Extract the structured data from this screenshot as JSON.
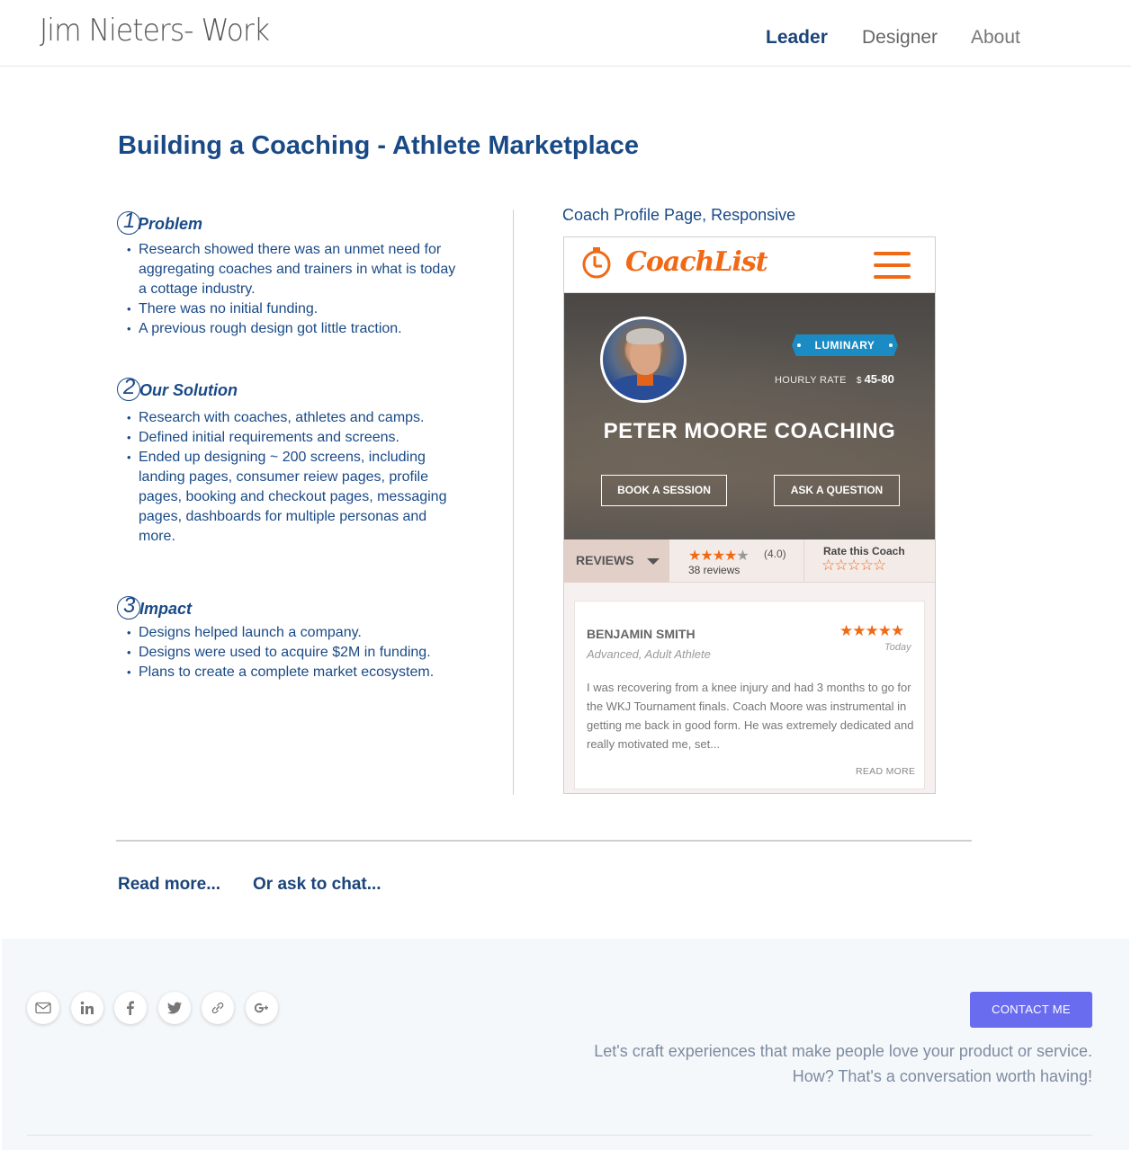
{
  "header": {
    "logo": "Jim Nieters- Work",
    "nav": [
      "Leader",
      "Designer",
      "About"
    ]
  },
  "page_title": "Building a Coaching - Athlete Marketplace",
  "sections": [
    {
      "number": "1",
      "title": "Problem",
      "bullets": [
        "Research showed there was an unmet need for aggregating coaches and trainers in what is today a cottage industry.",
        "There was no initial funding.",
        "A previous rough design got little traction."
      ]
    },
    {
      "number": "2",
      "title": "Our Solution",
      "bullets": [
        "Research with coaches, athletes and camps.",
        "Defined initial requirements and screens.",
        "Ended up designing ~ 200 screens, including landing pages, consumer reiew pages, profile pages, booking and checkout pages, messaging pages, dashboards for multiple personas and more."
      ]
    },
    {
      "number": "3",
      "title": "Impact",
      "bullets": [
        "Designs helped launch a company.",
        "Designs were used to acquire $2M in funding.",
        "Plans to create a complete market ecosystem."
      ]
    }
  ],
  "mockup": {
    "caption": "Coach Profile Page, Responsive",
    "app_name": "CoachList",
    "badge": "LUMINARY",
    "hourly_rate_label": "HOURLY RATE",
    "currency": "$",
    "hourly_rate": "45-80",
    "coach_name": "PETER MOORE COACHING",
    "book_button": "BOOK A SESSION",
    "ask_button": "ASK A QUESTION",
    "reviews_tab": "REVIEWS",
    "rating": 4.0,
    "rating_text": "(4.0)",
    "review_count": "38 reviews",
    "rate_label": "Rate this Coach",
    "review": {
      "name": "BENJAMIN SMITH",
      "subtitle": "Advanced, Adult Athlete",
      "stars": 5,
      "date": "Today",
      "text": "I was recovering from a knee injury and had 3 months to go for the WKJ Tournament finals. Coach Moore was instrumental in getting me back in good form. He was extremely dedicated and really motivated me, set...",
      "read_more": "READ MORE"
    },
    "colors": {
      "brand": "#f06a15",
      "badge": "#1a8bc3"
    }
  },
  "cta": {
    "read_more": "Read more...",
    "chat": "Or ask to chat..."
  },
  "footer": {
    "social_icons": [
      "email-icon",
      "linkedin-icon",
      "facebook-icon",
      "twitter-icon",
      "link-icon",
      "google-plus-icon"
    ],
    "contact_button": "CONTACT ME",
    "tagline_line1": "Let's craft experiences that make people love your product or service.",
    "tagline_line2": "How? That's a conversation worth having!"
  },
  "colors": {
    "primary": "#1a4a86",
    "contact": "#6a6cf0",
    "footer_bg": "#f5f8fb"
  }
}
